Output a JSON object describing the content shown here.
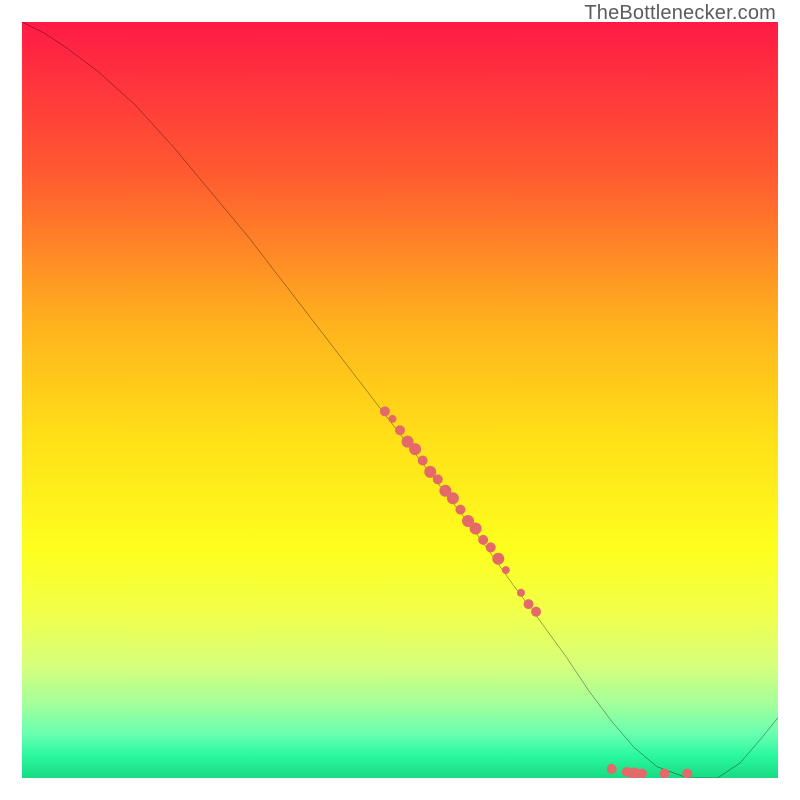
{
  "watermark": "TheBottlenecker.com",
  "chart_data": {
    "type": "line",
    "title": "",
    "xlabel": "",
    "ylabel": "",
    "xlim": [
      0,
      100
    ],
    "ylim": [
      0,
      100
    ],
    "gradient_stops": [
      {
        "offset": 0,
        "color": "#ff1a46"
      },
      {
        "offset": 0.2,
        "color": "#ff5a30"
      },
      {
        "offset": 0.4,
        "color": "#ffb21d"
      },
      {
        "offset": 0.55,
        "color": "#ffe018"
      },
      {
        "offset": 0.7,
        "color": "#fdff1e"
      },
      {
        "offset": 0.78,
        "color": "#f2ff4a"
      },
      {
        "offset": 0.85,
        "color": "#d7ff7a"
      },
      {
        "offset": 0.9,
        "color": "#a6ff9a"
      },
      {
        "offset": 0.94,
        "color": "#6bffb0"
      },
      {
        "offset": 0.97,
        "color": "#2bf8a0"
      },
      {
        "offset": 1.0,
        "color": "#18db82"
      }
    ],
    "series": [
      {
        "name": "bottleneck-curve",
        "x": [
          0,
          3,
          6,
          10,
          15,
          20,
          25,
          30,
          35,
          40,
          45,
          50,
          55,
          60,
          65,
          68,
          72,
          75,
          78,
          81,
          84,
          88,
          92,
          95,
          98,
          100
        ],
        "y": [
          100,
          98.5,
          96.5,
          93.5,
          89,
          83.5,
          77.5,
          71.5,
          65,
          58.5,
          52,
          45.5,
          39,
          32.5,
          25.5,
          21.5,
          16,
          11.5,
          7.5,
          4,
          1.5,
          0,
          0,
          2,
          5.5,
          8
        ]
      }
    ],
    "scatter_points": {
      "name": "data-points",
      "color": "#e46a6a",
      "points": [
        {
          "x": 48,
          "y": 48.5,
          "r": 5
        },
        {
          "x": 49,
          "y": 47.5,
          "r": 4
        },
        {
          "x": 50,
          "y": 46,
          "r": 5
        },
        {
          "x": 51,
          "y": 44.5,
          "r": 6
        },
        {
          "x": 52,
          "y": 43.5,
          "r": 6
        },
        {
          "x": 53,
          "y": 42,
          "r": 5
        },
        {
          "x": 54,
          "y": 40.5,
          "r": 6
        },
        {
          "x": 55,
          "y": 39.5,
          "r": 5
        },
        {
          "x": 56,
          "y": 38,
          "r": 6
        },
        {
          "x": 57,
          "y": 37,
          "r": 6
        },
        {
          "x": 58,
          "y": 35.5,
          "r": 5
        },
        {
          "x": 59,
          "y": 34,
          "r": 6
        },
        {
          "x": 60,
          "y": 33,
          "r": 6
        },
        {
          "x": 61,
          "y": 31.5,
          "r": 5
        },
        {
          "x": 62,
          "y": 30.5,
          "r": 5
        },
        {
          "x": 63,
          "y": 29,
          "r": 6
        },
        {
          "x": 64,
          "y": 27.5,
          "r": 4
        },
        {
          "x": 66,
          "y": 24.5,
          "r": 4
        },
        {
          "x": 67,
          "y": 23,
          "r": 5
        },
        {
          "x": 68,
          "y": 22,
          "r": 5
        },
        {
          "x": 78,
          "y": 1.2,
          "r": 5
        },
        {
          "x": 80,
          "y": 0.8,
          "r": 5
        },
        {
          "x": 81,
          "y": 0.6,
          "r": 6
        },
        {
          "x": 82,
          "y": 0.6,
          "r": 5
        },
        {
          "x": 85,
          "y": 0.6,
          "r": 5
        },
        {
          "x": 88,
          "y": 0.6,
          "r": 5
        }
      ]
    }
  }
}
